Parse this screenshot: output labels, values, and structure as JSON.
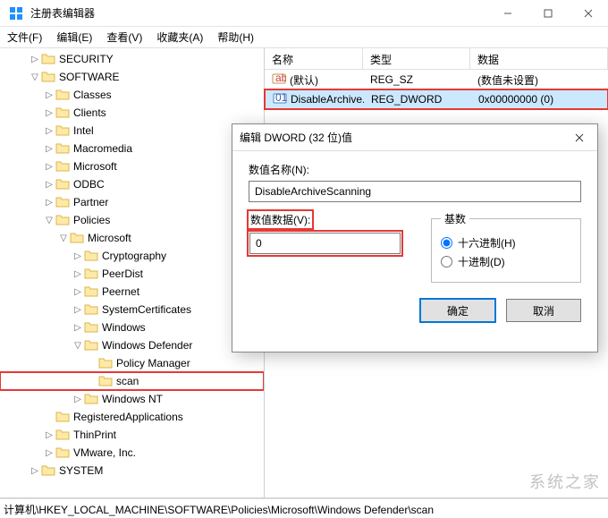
{
  "window": {
    "title": "注册表编辑器"
  },
  "menu": {
    "file": "文件(F)",
    "edit": "编辑(E)",
    "view": "查看(V)",
    "favorites": "收藏夹(A)",
    "help": "帮助(H)"
  },
  "tree": {
    "items": [
      {
        "depth": 2,
        "label": "SECURITY",
        "expand": "▷"
      },
      {
        "depth": 2,
        "label": "SOFTWARE",
        "expand": "▽"
      },
      {
        "depth": 3,
        "label": "Classes",
        "expand": "▷"
      },
      {
        "depth": 3,
        "label": "Clients",
        "expand": "▷"
      },
      {
        "depth": 3,
        "label": "Intel",
        "expand": "▷"
      },
      {
        "depth": 3,
        "label": "Macromedia",
        "expand": "▷"
      },
      {
        "depth": 3,
        "label": "Microsoft",
        "expand": "▷"
      },
      {
        "depth": 3,
        "label": "ODBC",
        "expand": "▷"
      },
      {
        "depth": 3,
        "label": "Partner",
        "expand": "▷"
      },
      {
        "depth": 3,
        "label": "Policies",
        "expand": "▽"
      },
      {
        "depth": 4,
        "label": "Microsoft",
        "expand": "▽"
      },
      {
        "depth": 5,
        "label": "Cryptography",
        "expand": "▷"
      },
      {
        "depth": 5,
        "label": "PeerDist",
        "expand": "▷"
      },
      {
        "depth": 5,
        "label": "Peernet",
        "expand": "▷"
      },
      {
        "depth": 5,
        "label": "SystemCertificates",
        "expand": "▷"
      },
      {
        "depth": 5,
        "label": "Windows",
        "expand": "▷"
      },
      {
        "depth": 5,
        "label": "Windows Defender",
        "expand": "▽"
      },
      {
        "depth": 6,
        "label": "Policy Manager",
        "expand": ""
      },
      {
        "depth": 6,
        "label": "scan",
        "expand": "",
        "selected": true
      },
      {
        "depth": 5,
        "label": "Windows NT",
        "expand": "▷"
      },
      {
        "depth": 3,
        "label": "RegisteredApplications",
        "expand": ""
      },
      {
        "depth": 3,
        "label": "ThinPrint",
        "expand": "▷"
      },
      {
        "depth": 3,
        "label": "VMware, Inc.",
        "expand": "▷"
      },
      {
        "depth": 2,
        "label": "SYSTEM",
        "expand": "▷"
      }
    ]
  },
  "list": {
    "columns": {
      "name": "名称",
      "type": "类型",
      "data": "数据"
    },
    "rows": [
      {
        "icon": "string",
        "name": "(默认)",
        "type": "REG_SZ",
        "data": "(数值未设置)"
      },
      {
        "icon": "binary",
        "name": "DisableArchive...",
        "type": "REG_DWORD",
        "data": "0x00000000 (0)",
        "selected": true,
        "highlighted": true
      }
    ]
  },
  "dialog": {
    "title": "编辑 DWORD (32 位)值",
    "name_label": "数值名称(N):",
    "name_value": "DisableArchiveScanning",
    "value_label": "数值数据(V):",
    "value_value": "0",
    "base_legend": "基数",
    "radio_hex": "十六进制(H)",
    "radio_dec": "十进制(D)",
    "ok": "确定",
    "cancel": "取消"
  },
  "statusbar": {
    "path": "计算机\\HKEY_LOCAL_MACHINE\\SOFTWARE\\Policies\\Microsoft\\Windows Defender\\scan"
  },
  "watermark": "系统之家"
}
